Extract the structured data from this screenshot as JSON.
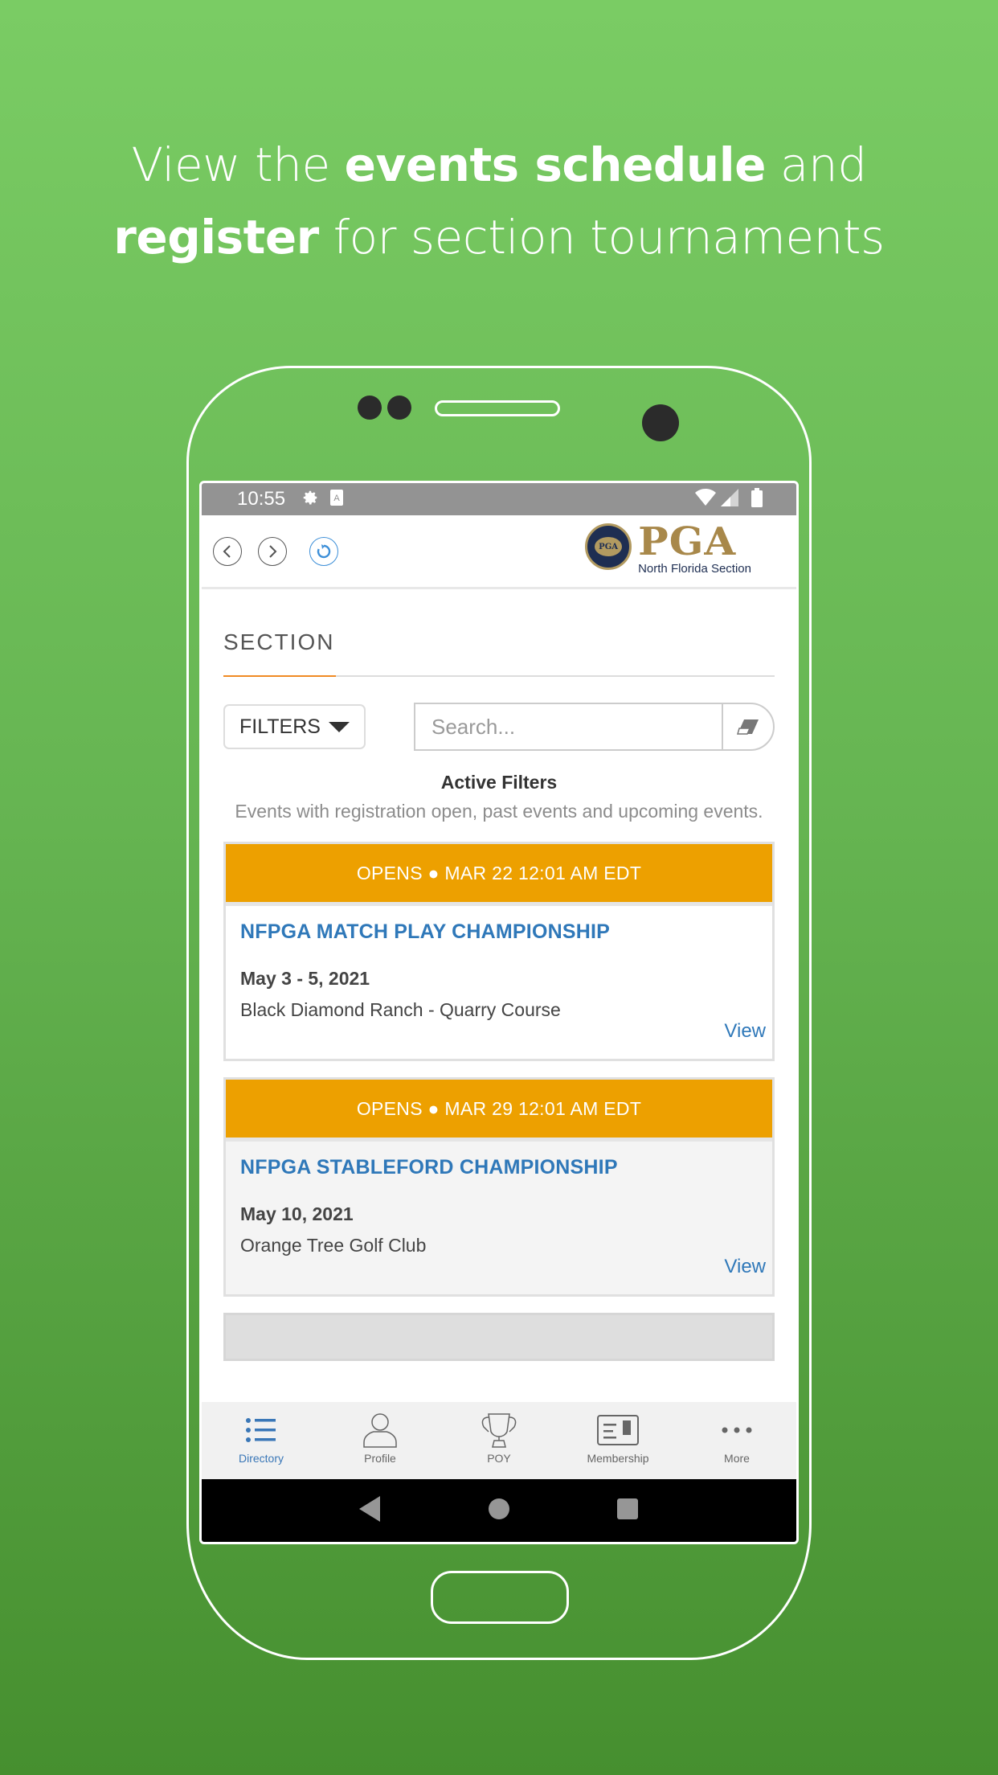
{
  "promo": {
    "line1_pre": "View the ",
    "line1_bold": "events schedule",
    "line1_post": " and",
    "line2_bold": "register",
    "line2_post": " for section tournaments"
  },
  "status_bar": {
    "time": "10:55",
    "icons_left": [
      "gear-icon",
      "a-icon"
    ],
    "icons_right": [
      "wifi-icon",
      "signal-icon",
      "battery-icon"
    ]
  },
  "header": {
    "nav_buttons": [
      "back",
      "forward",
      "refresh"
    ],
    "logo_main": "PGA",
    "logo_sub": "North Florida Section",
    "seal_text": "PGA"
  },
  "page": {
    "title": "SECTION",
    "filters_label": "FILTERS",
    "search_placeholder": "Search...",
    "active_filters_title": "Active Filters",
    "active_filters_desc": "Events with registration open, past events and upcoming events."
  },
  "events": [
    {
      "banner": "OPENS ● MAR 22 12:01 AM EDT",
      "name": "NFPGA MATCH PLAY CHAMPIONSHIP",
      "date": "May 3 - 5, 2021",
      "venue": "Black Diamond Ranch - Quarry Course",
      "action": "View"
    },
    {
      "banner": "OPENS ● MAR 29 12:01 AM EDT",
      "name": "NFPGA STABLEFORD CHAMPIONSHIP",
      "date": "May 10, 2021",
      "venue": "Orange Tree Golf Club",
      "action": "View"
    }
  ],
  "tab_bar": {
    "active": "Directory",
    "items": [
      {
        "label": "Directory",
        "icon": "list-icon"
      },
      {
        "label": "Profile",
        "icon": "person-icon"
      },
      {
        "label": "POY",
        "icon": "trophy-icon"
      },
      {
        "label": "Membership",
        "icon": "card-icon"
      },
      {
        "label": "More",
        "icon": "more-icon"
      }
    ]
  },
  "colors": {
    "accent_orange": "#eda000",
    "link_blue": "#2f78b9",
    "tab_active": "#3a77b7",
    "rule_orange": "#f08a24",
    "background_green": "#66b552"
  }
}
